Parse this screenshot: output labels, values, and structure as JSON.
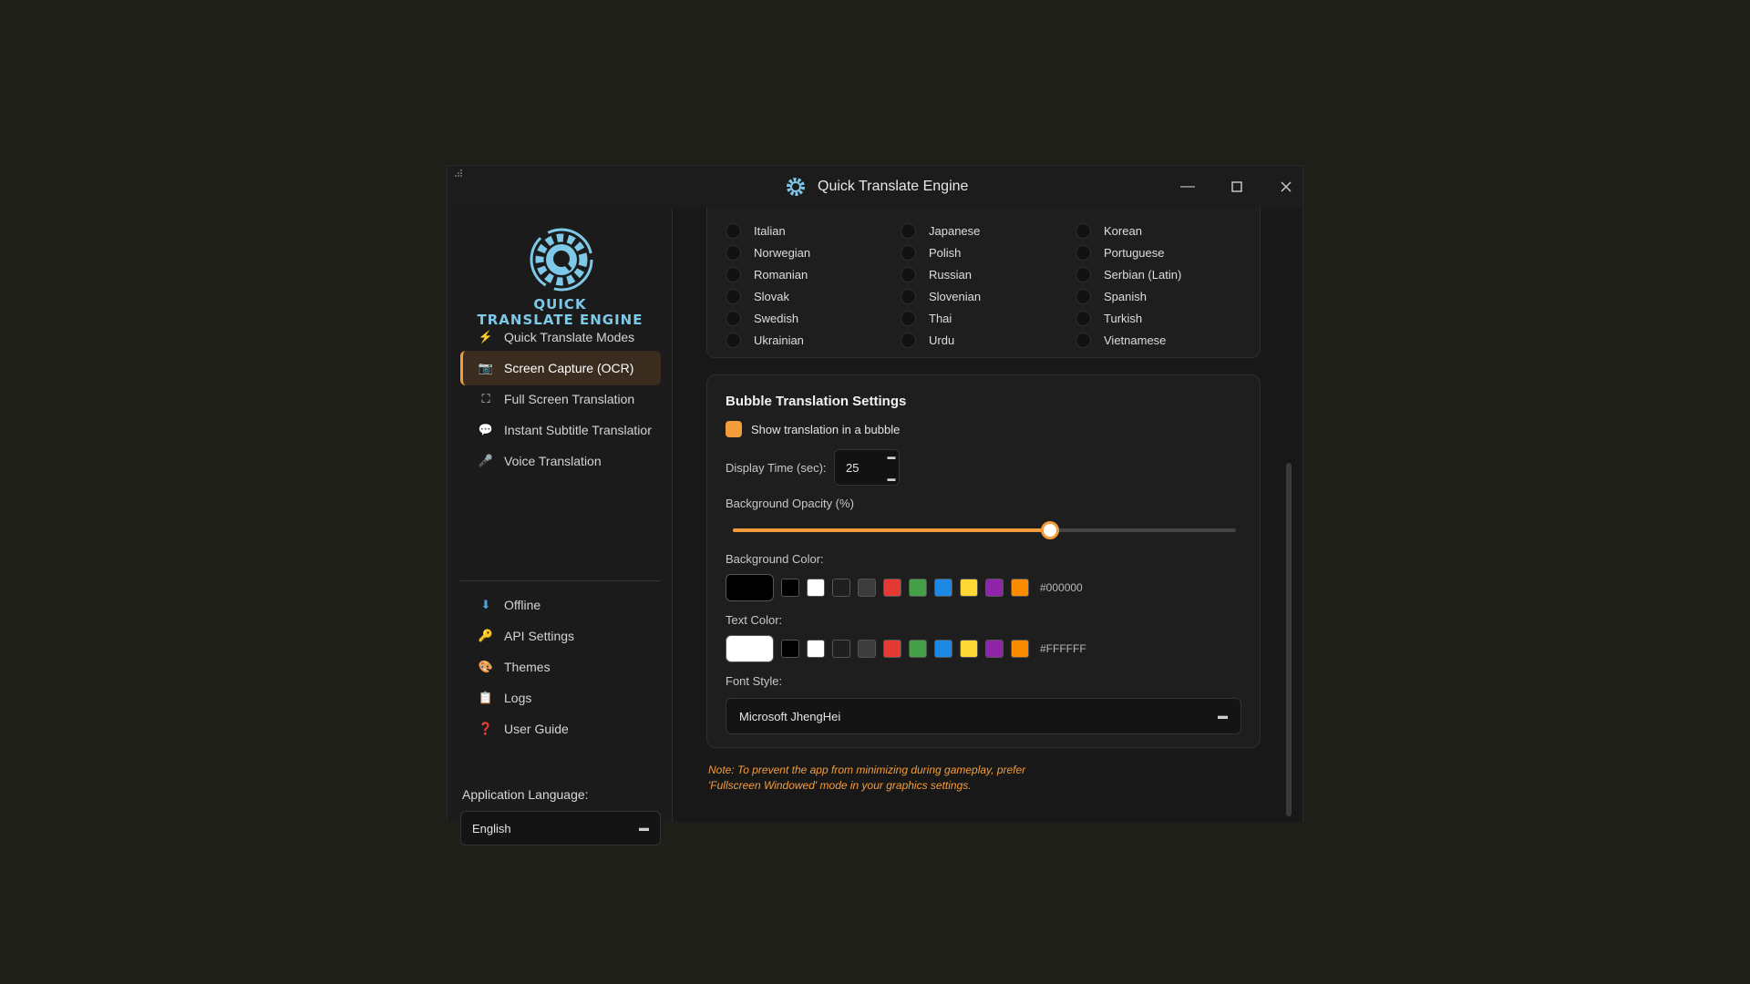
{
  "window": {
    "title": "Quick Translate Engine"
  },
  "sidebar": {
    "logo_line1": "QUICK",
    "logo_line2": "TRANSLATE ENGINE",
    "items": [
      {
        "label": "Quick Translate Modes",
        "icon": "⚡",
        "active": false
      },
      {
        "label": "Screen Capture (OCR)",
        "icon": "📷",
        "active": true
      },
      {
        "label": "Full Screen Translation",
        "icon": "⛶",
        "active": false
      },
      {
        "label": "Instant Subtitle Translatior",
        "icon": "💬",
        "active": false
      },
      {
        "label": "Voice Translation",
        "icon": "🎤",
        "active": false
      },
      {
        "label": "Offline",
        "icon": "⬇",
        "active": false
      },
      {
        "label": "API Settings",
        "icon": "🔑",
        "active": false
      },
      {
        "label": "Themes",
        "icon": "🎨",
        "active": false
      },
      {
        "label": "Logs",
        "icon": "📋",
        "active": false
      },
      {
        "label": "User Guide",
        "icon": "❓",
        "active": false
      }
    ],
    "app_language_label": "Application Language:",
    "app_language_value": "English"
  },
  "languages": {
    "col1": [
      "Italian",
      "Norwegian",
      "Romanian",
      "Slovak",
      "Swedish",
      "Ukrainian"
    ],
    "col2": [
      "Japanese",
      "Polish",
      "Russian",
      "Slovenian",
      "Thai",
      "Urdu"
    ],
    "col3": [
      "Korean",
      "Portuguese",
      "Serbian (Latin)",
      "Spanish",
      "Turkish",
      "Vietnamese"
    ]
  },
  "bubble": {
    "title": "Bubble Translation Settings",
    "show_bubble_label": "Show translation in a bubble",
    "show_bubble_checked": true,
    "display_time_label": "Display Time (sec):",
    "display_time_value": "25",
    "opacity_label": "Background Opacity (%)",
    "opacity_value": 63,
    "bg_color_label": "Background Color:",
    "bg_color_hex": "#000000",
    "text_color_label": "Text Color:",
    "text_color_hex": "#FFFFFF",
    "palette": [
      "#000000",
      "#ffffff",
      "#1f1f1f",
      "#3c3c3c",
      "#e53935",
      "#43a047",
      "#1e88e5",
      "#fdd835",
      "#8e24aa",
      "#fb8c00"
    ],
    "font_label": "Font Style:",
    "font_value": "Microsoft JhengHei"
  },
  "note": "Note: To prevent the app from minimizing during gameplay, prefer 'Fullscreen Windowed' mode in your graphics settings.",
  "colors": {
    "accent": "#f39c3b",
    "logo": "#7ec8e8",
    "background": "#181818"
  }
}
